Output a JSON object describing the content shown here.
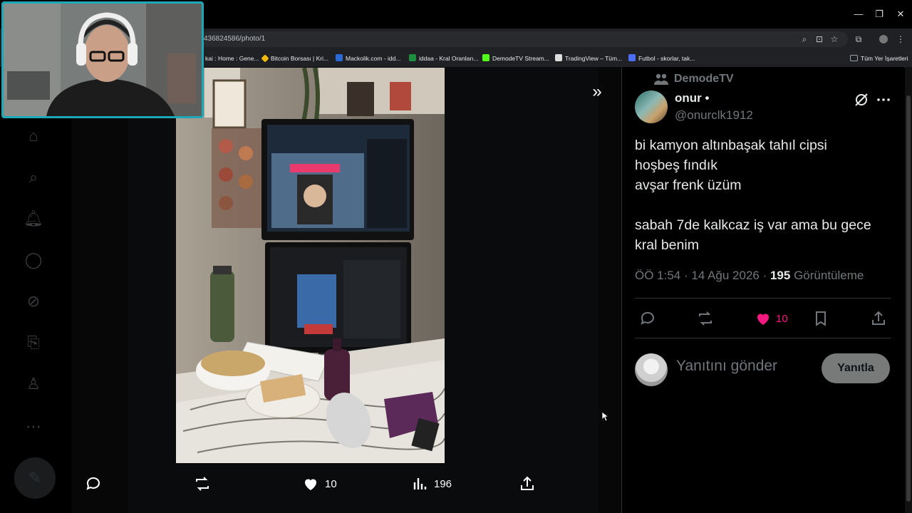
{
  "browser": {
    "url": "436824586/photo/1",
    "bookmarks": [
      {
        "label": "kai : Home : Gene...",
        "color": "#5f6368"
      },
      {
        "label": "Bitcoin Borsası | Kri...",
        "color": "#f0b90b"
      },
      {
        "label": "Mackolik.com - idd...",
        "color": "#2a6ad6"
      },
      {
        "label": "iddaa - Kral Oranları...",
        "color": "#1e8e3e"
      },
      {
        "label": "DemodeTV Stream...",
        "color": "#53fc18"
      },
      {
        "label": "TradingView – Tüm...",
        "color": "#dddddd"
      },
      {
        "label": "Futbol - skorlar, tak...",
        "color": "#4c6ef5"
      },
      {
        "label": "Tüm Yer İşaretleri",
        "color": "#9aa0a6"
      }
    ]
  },
  "photo_actions": {
    "likes": "10",
    "views": "196"
  },
  "tweet": {
    "community": "DemodeTV",
    "display_name": "onur •",
    "handle": "@onurclk1912",
    "lines": [
      "bi kamyon altınbaşak tahıl cipsi",
      "hoşbeş fındık",
      "avşar frenk üzüm",
      "",
      "sabah 7de kalkcaz iş var ama bu gece",
      "kral benim"
    ],
    "time": "ÖÖ 1:54 · 14 Ağu 2026 · ",
    "views_count": "195",
    "views_label": "Görüntüleme",
    "likes": "10",
    "reply_placeholder": "Yanıtını gönder",
    "reply_button": "Yanıtla"
  },
  "colors": {
    "like_pink": "#f91880",
    "webcam_border": "#1ba9b9"
  }
}
